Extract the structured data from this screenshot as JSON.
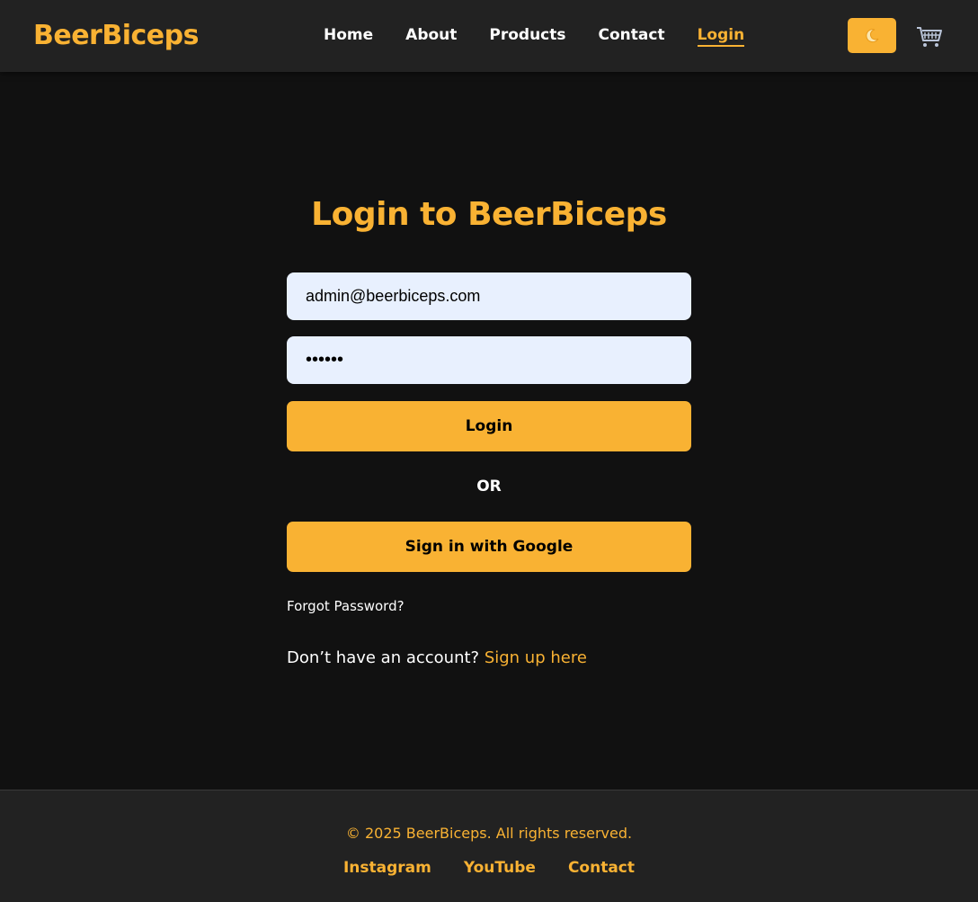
{
  "header": {
    "brand": "BeerBiceps",
    "nav": [
      {
        "label": "Home",
        "active": false
      },
      {
        "label": "About",
        "active": false
      },
      {
        "label": "Products",
        "active": false
      },
      {
        "label": "Contact",
        "active": false
      },
      {
        "label": "Login",
        "active": true
      }
    ],
    "theme_toggle_icon": "moon-icon",
    "cart_icon": "cart-icon"
  },
  "login": {
    "title": "Login to BeerBiceps",
    "email_value": "admin@beerbiceps.com",
    "password_value": "••••••",
    "login_button": "Login",
    "or_label": "OR",
    "google_button": "Sign in with Google",
    "forgot_password": "Forgot Password?",
    "signup_prompt": "Don’t have an account?",
    "signup_link": "Sign up here"
  },
  "footer": {
    "copyright": "© 2025 BeerBiceps. All rights reserved.",
    "links": [
      "Instagram",
      "YouTube",
      "Contact"
    ]
  },
  "colors": {
    "accent": "#f9b233",
    "background": "#111111",
    "header_bg": "#222222",
    "input_bg": "#e8f0fe"
  }
}
